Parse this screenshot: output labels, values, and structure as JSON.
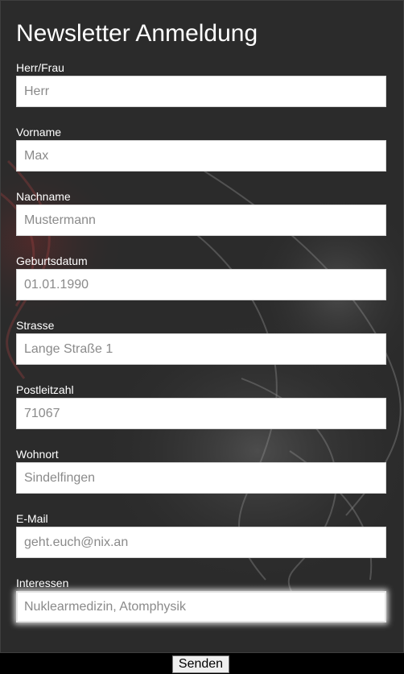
{
  "form": {
    "title": "Newsletter Anmeldung",
    "fields": [
      {
        "label": "Herr/Frau",
        "placeholder": "Herr",
        "value": ""
      },
      {
        "label": "Vorname",
        "placeholder": "Max",
        "value": ""
      },
      {
        "label": "Nachname",
        "placeholder": "Mustermann",
        "value": ""
      },
      {
        "label": "Geburtsdatum",
        "placeholder": "01.01.1990",
        "value": ""
      },
      {
        "label": "Strasse",
        "placeholder": "Lange Straße 1",
        "value": ""
      },
      {
        "label": "Postleitzahl",
        "placeholder": "71067",
        "value": ""
      },
      {
        "label": "Wohnort",
        "placeholder": "Sindelfingen",
        "value": ""
      },
      {
        "label": "E-Mail",
        "placeholder": "geht.euch@nix.an",
        "value": ""
      },
      {
        "label": "Interessen",
        "placeholder": "Nuklearmedizin, Atomphysik",
        "value": "",
        "focused": true
      }
    ],
    "submit_label": "Senden"
  },
  "colors": {
    "panel_background": "#2b2b2b",
    "page_background": "#000000",
    "label_text": "#ffffff",
    "placeholder_text": "#8a8a8a"
  }
}
